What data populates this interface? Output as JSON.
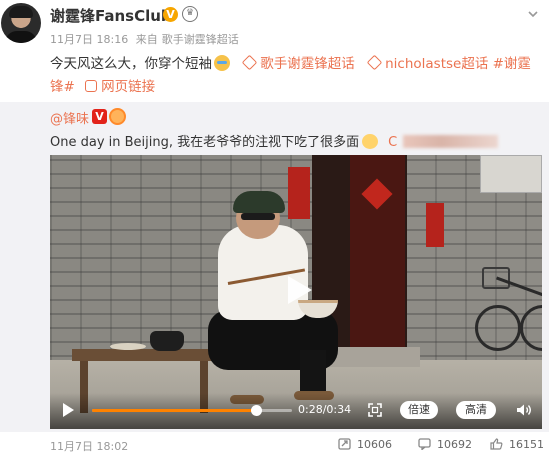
{
  "post": {
    "author": "谢霆锋FansClub",
    "verified_badge": "V",
    "date": "11月7日 18:16",
    "source_prefix": "来自",
    "source": "歌手谢霆锋超话",
    "text": "今天风这么大，你穿个短袖",
    "topic1": "歌手谢霆锋超话",
    "topic2": "nicholastse超话",
    "hashtag_prefix": "#谢霆",
    "hashtag_suffix": "锋#",
    "link_label": "网页链接"
  },
  "repost": {
    "author": "@锋味",
    "verified_badge": "V",
    "text": "One day in Beijing, 我在老爷爷的注视下吃了很多面",
    "trailing_visible": "C"
  },
  "video": {
    "current_time": "0:28",
    "duration": "0:34",
    "time_display": "0:28/0:34",
    "progress": 0.82,
    "speed_label": "倍速",
    "quality_label": "高清"
  },
  "footer": {
    "date": "11月7日 18:02",
    "reposts": "10606",
    "comments": "10692",
    "likes": "16151"
  },
  "colors": {
    "accent_orange": "#eb7350",
    "progress_orange": "#ff8200",
    "vip_gold": "#f7a600",
    "verified_red": "#e2231a",
    "repost_bg": "#f2f2f5"
  }
}
